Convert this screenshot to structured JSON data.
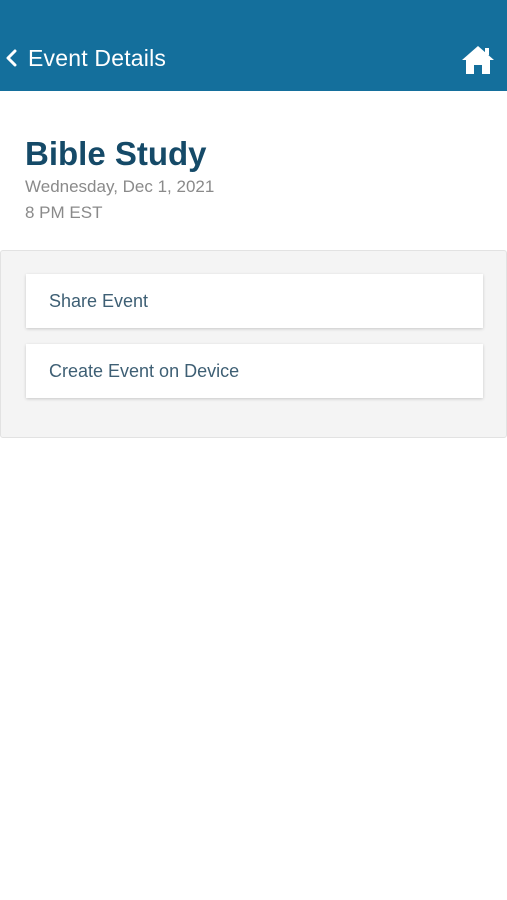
{
  "header": {
    "title": "Event Details",
    "back_icon": "chevron-left-icon",
    "home_icon": "home-icon",
    "background_color": "#146f9c"
  },
  "event": {
    "title": "Bible Study",
    "date": "Wednesday, Dec 1, 2021",
    "time": "8 PM EST"
  },
  "actions": {
    "share_label": "Share Event",
    "create_label": "Create Event on Device"
  }
}
